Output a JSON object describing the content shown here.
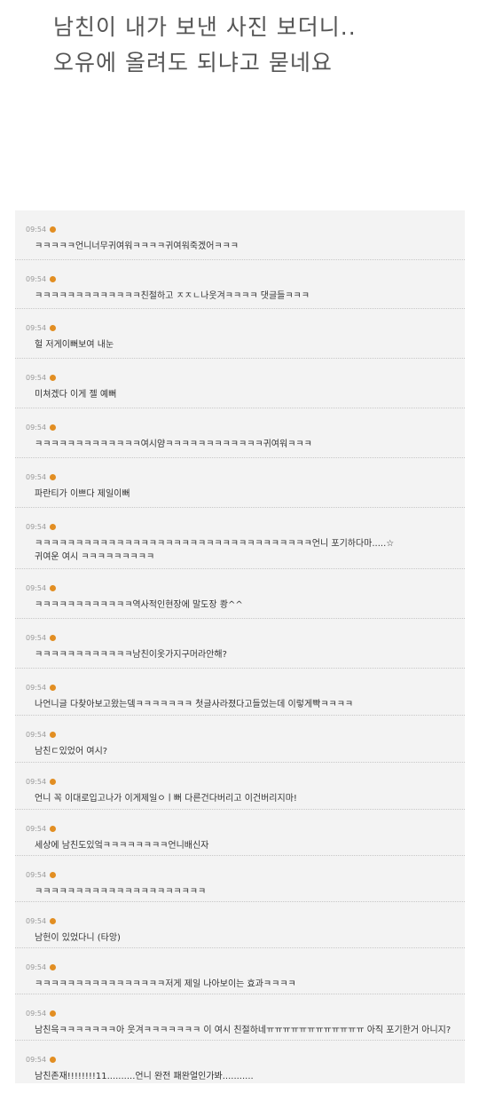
{
  "header": {
    "line1": "남친이 내가 보낸 사진 보더니..",
    "line2": "오유에 올려도 되냐고 묻네요"
  },
  "colors": {
    "badge": "#e28e22",
    "panel": "#f3f3f3"
  },
  "comments": [
    {
      "time": "09:54",
      "text": "ㅋㅋㅋㅋㅋ언니너무귀여워ㅋㅋㅋㅋ귀여워죽겠어ㅋㅋㅋ"
    },
    {
      "time": "09:54",
      "text": "ㅋㅋㅋㅋㅋㅋㅋㅋㅋㅋㅋㅋㅋ친절하고 ㅈㅈㄴ나웃겨ㅋㅋㅋㅋ 댓글들ㅋㅋㅋ"
    },
    {
      "time": "09:54",
      "text": "헐 저게이뻐보여 내눈"
    },
    {
      "time": "09:54",
      "text": "미쳐겠다 이게 젤 예뻐"
    },
    {
      "time": "09:54",
      "text": "ㅋㅋㅋㅋㅋㅋㅋㅋㅋㅋㅋㅋㅋ여시얌ㅋㅋㅋㅋㅋㅋㅋㅋㅋㅋㅋㅋ귀여워ㅋㅋㅋ"
    },
    {
      "time": "09:54",
      "text": "파란티가 이쁘다 제일이뻐"
    },
    {
      "time": "09:54",
      "text": "ㅋㅋㅋㅋㅋㅋㅋㅋㅋㅋㅋㅋㅋㅋㅋㅋㅋㅋㅋㅋㅋㅋㅋㅋㅋㅋㅋㅋㅋㅋㅋㅋㅋㅋ언니 포기하다마.....☆\n귀여운 여시 ㅋㅋㅋㅋㅋㅋㅋㅋㅋ"
    },
    {
      "time": "09:54",
      "text": "ㅋㅋㅋㅋㅋㅋㅋㅋㅋㅋㅋㅋ역사적인현장에 말도장 쾅^^"
    },
    {
      "time": "09:54",
      "text": "ㅋㅋㅋㅋㅋㅋㅋㅋㅋㅋㅋㅋ남친이옷가지구머라안해?"
    },
    {
      "time": "09:54",
      "text": "나언니글 다찾아보고왔는뎈ㅋㅋㅋㅋㅋㅋㅋ 첫글사라졌다고들었는데 이렇게빡ㅋㅋㅋㅋ"
    },
    {
      "time": "09:54",
      "text": "남친ㄷ있었어 여시?"
    },
    {
      "time": "09:54",
      "text": "언니 꼭 이대로입고나가 이게제일ㅇㅣ뻐 다른건다버리고 이건버리지마!"
    },
    {
      "time": "09:54",
      "text": "세상에 남친도있엌ㅋㅋㅋㅋㅋㅋㅋㅋ언니배신자"
    },
    {
      "time": "09:54",
      "text": "ㅋㅋㅋㅋㅋㅋㅋㅋㅋㅋㅋㅋㅋㅋㅋㅋㅋㅋㅋㅋㅋ"
    },
    {
      "time": "09:54",
      "text": "남헌이 있었다니 (타앙)"
    },
    {
      "time": "09:54",
      "text": "ㅋㅋㅋㅋㅋㅋㅋㅋㅋㅋㅋㅋㅋㅋㅋㅋ저게 제일 나아보이는 효과ㅋㅋㅋㅋ"
    },
    {
      "time": "09:54",
      "text": "남친윽ㅋㅋㅋㅋㅋㅋㅋ아 웃겨ㅋㅋㅋㅋㅋㅋㅋ 이 여시 친절하네ㅠㅠㅠㅠㅠㅠㅠㅠㅠㅠㅠㅠ 아직 포기한거 아니지?"
    },
    {
      "time": "09:54",
      "text": "남친존재!!!!!!!!11..........언니 완전 패완얼인가봐..........."
    }
  ]
}
